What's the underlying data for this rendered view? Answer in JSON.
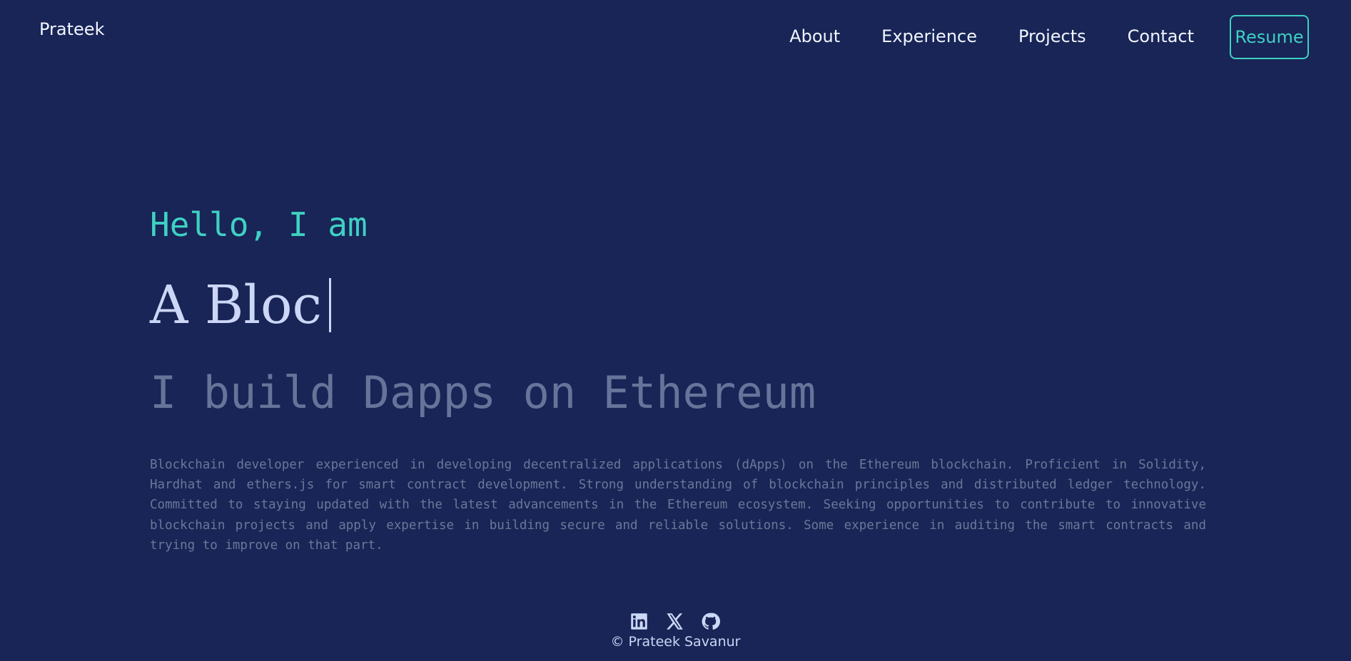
{
  "header": {
    "brand": "Prateek",
    "nav": [
      {
        "label": "About"
      },
      {
        "label": "Experience"
      },
      {
        "label": "Projects"
      },
      {
        "label": "Contact"
      }
    ],
    "resume_label": "Resume"
  },
  "hero": {
    "greeting": "Hello, I am",
    "role_typed": "A Bloc",
    "tagline": "I build Dapps on Ethereum",
    "bio": "Blockchain developer experienced in developing decentralized applications (dApps) on the Ethereum blockchain. Proficient in Solidity, Hardhat and ethers.js for smart contract development. Strong understanding of blockchain principles and distributed ledger technology. Committed to staying updated with the latest advancements in the Ethereum ecosystem. Seeking opportunities to contribute to innovative blockchain projects and apply expertise in building secure and reliable solutions. Some experience in auditing the smart contracts and trying to improve on that part."
  },
  "footer": {
    "socials": [
      {
        "icon": "linkedin-icon"
      },
      {
        "icon": "x-twitter-icon"
      },
      {
        "icon": "github-icon"
      }
    ],
    "copyright": "© Prateek Savanur"
  },
  "colors": {
    "background": "#182556",
    "accent": "#3fd0c4",
    "heading": "#ccd6f6",
    "muted": "#66749a"
  }
}
